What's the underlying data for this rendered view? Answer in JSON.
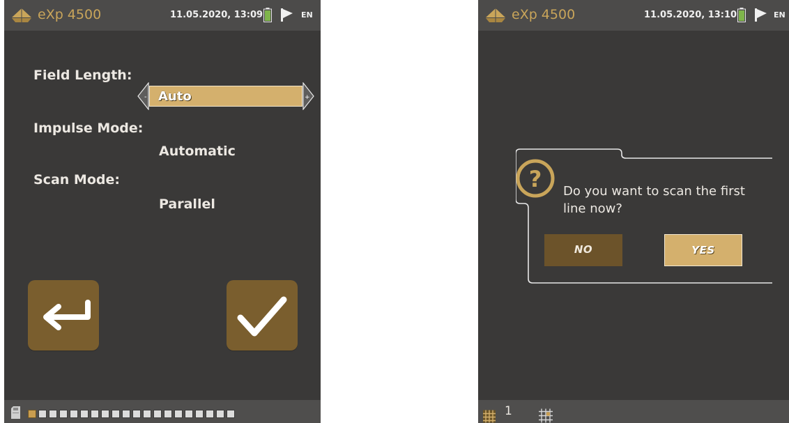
{
  "left_screen": {
    "statusbar": {
      "app_title": "eXp 4500",
      "datetime": "11.05.2020, 13:09",
      "language": "EN"
    },
    "settings": {
      "field_length_label": "Field Length:",
      "field_length_value": "Auto",
      "impulse_mode_label": "Impulse Mode:",
      "impulse_mode_value": "Automatic",
      "scan_mode_label": "Scan Mode:",
      "scan_mode_value": "Parallel"
    },
    "progress": {
      "total_segments": 20,
      "active_segments": 1
    }
  },
  "right_screen": {
    "statusbar": {
      "app_title": "eXp 4500",
      "datetime": "11.05.2020, 13:10",
      "language": "EN"
    },
    "dialog": {
      "message": "Do you want to scan the first line now?",
      "no_label": "NO",
      "yes_label": "YES"
    },
    "bottombar": {
      "line_count": "1"
    }
  },
  "icons": {
    "logo": "ground-scanner-logo-icon",
    "battery": "battery-icon",
    "language": "flag-icon",
    "back": "return-arrow-icon",
    "confirm": "checkmark-icon",
    "question": "question-icon",
    "storage": "sd-card-icon",
    "grid": "scan-grid-icon",
    "grid_pattern": "grid-pattern-icon"
  },
  "colors": {
    "screen_bg": "#3a3938",
    "bar_bg": "#4c4b4a",
    "accent_gold": "#c9a55a",
    "field_highlight": "#d4b06d",
    "button_brown": "#7a5e2e",
    "battery_green": "#7fb54b"
  }
}
